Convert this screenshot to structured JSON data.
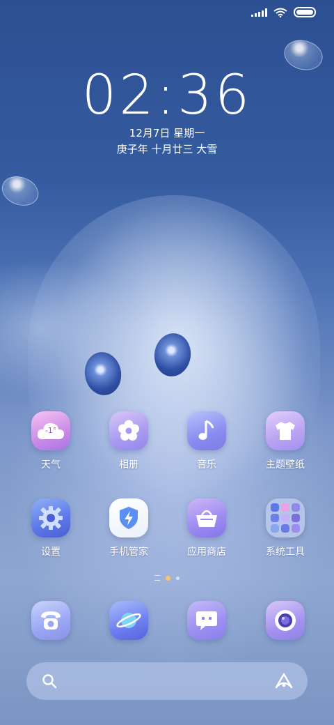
{
  "status_bar": {
    "icons": [
      "signal-icon",
      "wifi-icon",
      "battery-icon"
    ]
  },
  "lockclock": {
    "time": "02:36",
    "date": "12月7日 星期一",
    "lunar": "庚子年 十月廿三 大雪"
  },
  "weather_widget": {
    "temperature": "-1°"
  },
  "apps": [
    {
      "label": "天气",
      "icon": "weather-cloud-icon"
    },
    {
      "label": "相册",
      "icon": "flower-icon"
    },
    {
      "label": "音乐",
      "icon": "music-note-icon"
    },
    {
      "label": "主题壁纸",
      "icon": "tshirt-icon"
    },
    {
      "label": "设置",
      "icon": "gear-icon"
    },
    {
      "label": "手机管家",
      "icon": "shield-lightning-icon"
    },
    {
      "label": "应用商店",
      "icon": "basket-icon"
    },
    {
      "label": "系统工具",
      "icon": "folder-icon"
    }
  ],
  "page_indicator": {
    "pages": 2,
    "active_page": 1
  },
  "dock": [
    {
      "icon": "phone-icon"
    },
    {
      "icon": "browser-planet-icon"
    },
    {
      "icon": "messages-icon"
    },
    {
      "icon": "camera-icon"
    }
  ],
  "search_bar": {
    "left_icon": "search-icon",
    "right_icon": "assistant-icon"
  },
  "colors": {
    "sky_top": "#2c4f91",
    "sky_bottom": "#7b94c3",
    "page_dot_active": "#f6c66a"
  }
}
